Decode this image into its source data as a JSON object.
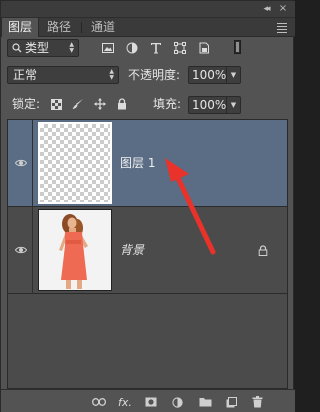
{
  "chrome": {
    "collapse_glyph": "◂◂",
    "close_glyph": "×"
  },
  "tabs": [
    {
      "label": "图层",
      "active": true
    },
    {
      "label": "路径",
      "active": false
    },
    {
      "label": "通道",
      "active": false
    }
  ],
  "filter": {
    "kind_label": "类型",
    "icons": [
      "image-filter-icon",
      "adjustment-filter-icon",
      "type-filter-icon",
      "shape-filter-icon",
      "smart-object-filter-icon"
    ]
  },
  "blend": {
    "mode": "正常",
    "opacity_label": "不透明度:",
    "opacity_value": "100%"
  },
  "lock": {
    "label": "锁定:",
    "fill_label": "填充:",
    "fill_value": "100%"
  },
  "layers": [
    {
      "name": "图层 1",
      "selected": true,
      "visible": true,
      "locked": false,
      "thumbnail": "transparent-checkerboard"
    },
    {
      "name": "背景",
      "selected": false,
      "visible": true,
      "locked": true,
      "thumbnail": "woman-red-dress-photo"
    }
  ],
  "colors": {
    "selected_layer": "#5b6d84",
    "panel_bg": "#535353",
    "annotation_arrow": "#e8322a"
  }
}
